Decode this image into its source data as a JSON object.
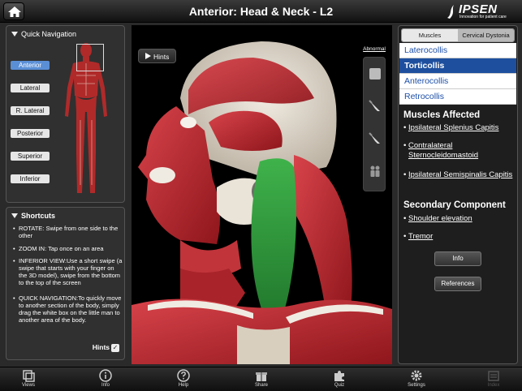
{
  "header": {
    "title": "Anterior: Head & Neck - L2",
    "brand_name": "IPSEN",
    "brand_tagline": "Innovation for patient care"
  },
  "quick_navigation": {
    "heading": "Quick Navigation",
    "views": [
      {
        "label": "Anterior",
        "active": true
      },
      {
        "label": "Lateral",
        "active": false
      },
      {
        "label": "R. Lateral",
        "active": false
      },
      {
        "label": "Posterior",
        "active": false
      },
      {
        "label": "Superior",
        "active": false
      },
      {
        "label": "Inferior",
        "active": false
      }
    ]
  },
  "shortcuts": {
    "heading": "Shortcuts",
    "items": [
      "ROTATE: Swipe from one side to the other",
      "ZOOM IN: Tap once on an area",
      "INFERIOR VIEW:Use a short swipe (a swipe that starts with your finger on the 3D model), swipe from the bottom to the top of the screen",
      "QUICK NAVIGATION:To quickly move to another section of the body, simply drag the white box on the little man to another area of the body."
    ],
    "hints_label": "Hints",
    "hints_checked": true
  },
  "viewport": {
    "hints_button": "Hints",
    "abnormal_link": "Abnormal",
    "tools": [
      "square-select-icon",
      "scalpel-icon",
      "scalpel-icon",
      "people-icon"
    ]
  },
  "right_panel": {
    "segments": [
      "Muscles",
      "Cervical Dystonia"
    ],
    "dystonia_types": [
      {
        "label": "Laterocollis",
        "selected": false
      },
      {
        "label": "Torticollis",
        "selected": true
      },
      {
        "label": "Anterocollis",
        "selected": false
      },
      {
        "label": "Retrocollis",
        "selected": false
      }
    ],
    "muscles_affected_title": "Muscles Affected",
    "muscles_affected": [
      "Ipsilateral Splenius Capitis",
      "Contralateral Sternocleidomastoid",
      "Ipsilateral Semispinalis Capitis"
    ],
    "secondary_title": "Secondary Component",
    "secondary": [
      "Shoulder elevation",
      "Tremor"
    ],
    "info_button": "Info",
    "references_button": "References"
  },
  "tabbar": [
    {
      "label": "Views",
      "icon": "views-icon",
      "enabled": true
    },
    {
      "label": "Info",
      "icon": "info-icon",
      "enabled": true
    },
    {
      "label": "Help",
      "icon": "help-icon",
      "enabled": true
    },
    {
      "label": "Share",
      "icon": "gift-icon",
      "enabled": true
    },
    {
      "label": "Quiz",
      "icon": "puzzle-icon",
      "enabled": true
    },
    {
      "label": "Settings",
      "icon": "gear-icon",
      "enabled": true
    },
    {
      "label": "Index",
      "icon": "index-icon",
      "enabled": false
    }
  ],
  "colors": {
    "selected_blue": "#1d4f9e",
    "active_view_blue": "#5a8fd6",
    "muscle_red": "#b8242a",
    "highlight_green": "#2f9a3c"
  }
}
